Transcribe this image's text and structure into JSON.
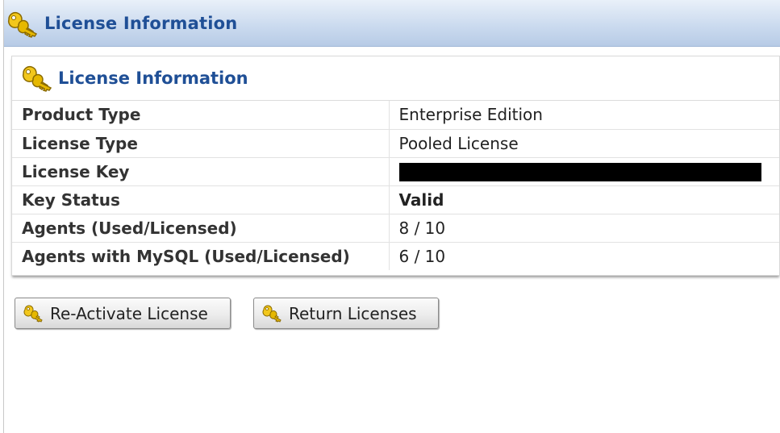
{
  "header": {
    "title": "License Information",
    "icon": "key-icon"
  },
  "panel": {
    "title": "License Information",
    "icon": "key-icon",
    "rows": [
      {
        "label": "Product Type",
        "value": "Enterprise Edition"
      },
      {
        "label": "License Type",
        "value": "Pooled License"
      },
      {
        "label": "License Key",
        "value": ""
      },
      {
        "label": "Key Status",
        "value": "Valid"
      },
      {
        "label": "Agents (Used/Licensed)",
        "value": "8 / 10"
      },
      {
        "label": "Agents with MySQL (Used/Licensed)",
        "value": "6 / 10"
      }
    ]
  },
  "buttons": {
    "reactivate_label": "Re-Activate License",
    "return_label": "Return Licenses"
  },
  "colors": {
    "title_blue": "#1f4f96",
    "valid_green": "#1e8a1e",
    "key_gold": "#e6b800"
  }
}
